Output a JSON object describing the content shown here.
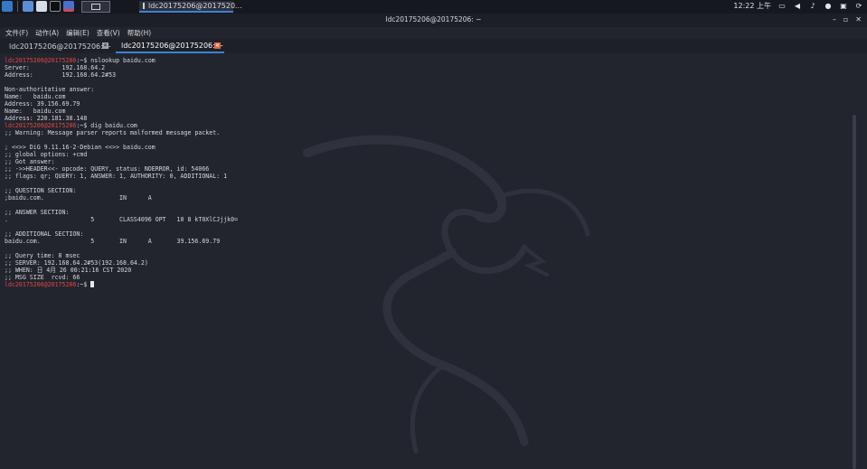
{
  "panel": {
    "taskbar_title": "ldc20175206@2017520...",
    "clock": "12:22 上午"
  },
  "window": {
    "title": "ldc20175206@20175206: ~"
  },
  "menu": [
    "文件(F)",
    "动作(A)",
    "编辑(E)",
    "查看(V)",
    "帮助(H)"
  ],
  "tabs": [
    {
      "label": "ldc20175206@20175206: ~"
    },
    {
      "label": "ldc20175206@20175206: ~"
    }
  ],
  "terminal": {
    "prompt": "ldc20175206@20175206",
    "prompt_suffix": ":~$ ",
    "cmd1": "nslookup baidu.com",
    "out1": "Server:         192.168.64.2\nAddress:        192.168.64.2#53\n\nNon-authoritative answer:\nName:   baidu.com\nAddress: 39.156.69.79\nName:   baidu.com\nAddress: 220.181.38.148\n",
    "cmd2": "dig baidu.com",
    "out2": ";; Warning: Message parser reports malformed message packet.\n\n; <<>> DiG 9.11.16-2-Debian <<>> baidu.com\n;; global options: +cmd\n;; Got answer:\n;; ->>HEADER<<- opcode: QUERY, status: NOERROR, id: 54066\n;; flags: qr; QUERY: 1, ANSWER: 1, AUTHORITY: 0, ADDITIONAL: 1\n\n;; QUESTION SECTION:\n;baidu.com.                     IN      A\n\n;; ANSWER SECTION:\n.                       5       CLASS4096 OPT   10 8 kT0XlCJjjk0=\n\n;; ADDITIONAL SECTION:\nbaidu.com.              5       IN      A       39.156.69.79\n\n;; Query time: 8 msec\n;; SERVER: 192.168.64.2#53(192.168.64.2)\n;; WHEN: 日 4月 26 00:21:16 CST 2020\n;; MSG SIZE  rcvd: 66\n"
  },
  "colors": {
    "background": "#23252e",
    "prompt": "#e04646",
    "accent": "#3b82d6"
  }
}
